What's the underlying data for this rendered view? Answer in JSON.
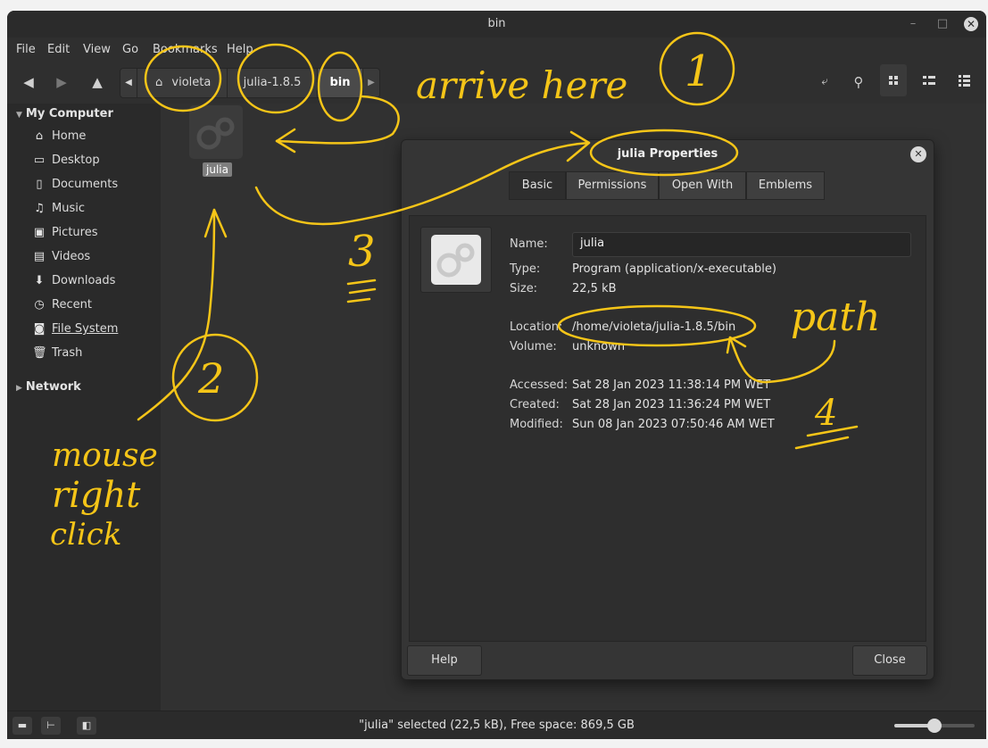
{
  "window": {
    "title": "bin"
  },
  "menu": [
    "File",
    "Edit",
    "View",
    "Go",
    "Bookmarks",
    "Help"
  ],
  "breadcrumb": [
    "violeta",
    "julia-1.8.5",
    "bin"
  ],
  "sidebar": {
    "section1": "My Computer",
    "items": [
      {
        "label": "Home",
        "icon": "home-icon"
      },
      {
        "label": "Desktop",
        "icon": "desktop-icon"
      },
      {
        "label": "Documents",
        "icon": "document-icon"
      },
      {
        "label": "Music",
        "icon": "music-icon"
      },
      {
        "label": "Pictures",
        "icon": "pictures-icon"
      },
      {
        "label": "Videos",
        "icon": "video-icon"
      },
      {
        "label": "Downloads",
        "icon": "download-icon"
      },
      {
        "label": "Recent",
        "icon": "clock-icon"
      },
      {
        "label": "File System",
        "icon": "drive-icon"
      },
      {
        "label": "Trash",
        "icon": "trash-icon"
      }
    ],
    "section2": "Network"
  },
  "file": {
    "name": "julia"
  },
  "status": {
    "text": "\"julia\" selected (22,5 kB), Free space: 869,5 GB",
    "zoom": 0.5
  },
  "dialog": {
    "title": "julia Properties",
    "tabs": [
      "Basic",
      "Permissions",
      "Open With",
      "Emblems"
    ],
    "fields": {
      "name_label": "Name:",
      "name_value": "julia",
      "type_label": "Type:",
      "type_value": "Program (application/x-executable)",
      "size_label": "Size:",
      "size_value": "22,5 kB",
      "location_label": "Location:",
      "location_value": "/home/violeta/julia-1.8.5/bin",
      "volume_label": "Volume:",
      "volume_value": "unknown",
      "accessed_label": "Accessed:",
      "accessed_value": "Sat 28 Jan 2023 11:38:14 PM WET",
      "created_label": "Created:",
      "created_value": "Sat 28 Jan 2023 11:36:24 PM WET",
      "modified_label": "Modified:",
      "modified_value": "Sun 08 Jan 2023 07:50:46 AM WET"
    },
    "help_label": "Help",
    "close_label": "Close"
  },
  "annotations": {
    "arrive_here": "arrive here",
    "num1": "1",
    "num2": "2",
    "num3": "3",
    "num4": "4",
    "path": "path",
    "mouse": "mouse",
    "right": "right",
    "click": "click",
    "color": "#f5c518"
  }
}
